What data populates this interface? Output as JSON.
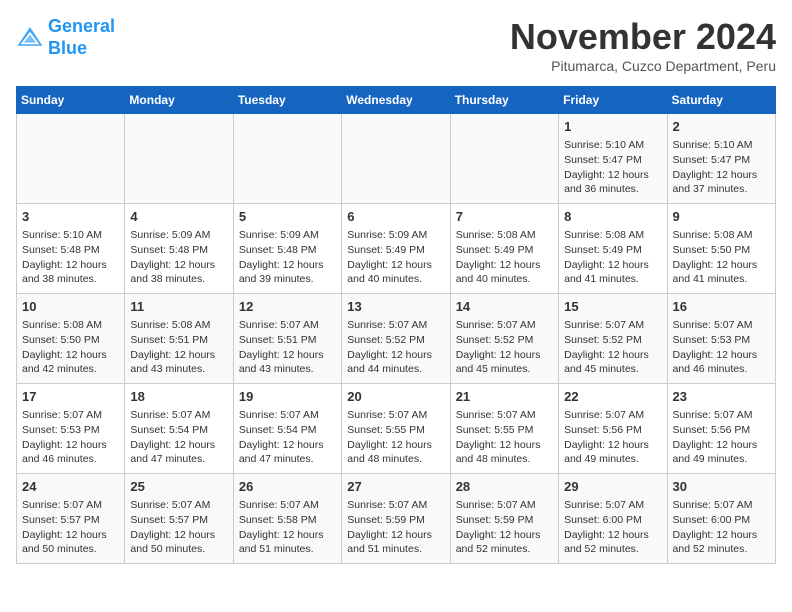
{
  "header": {
    "logo_line1": "General",
    "logo_line2": "Blue",
    "month": "November 2024",
    "location": "Pitumarca, Cuzco Department, Peru"
  },
  "days_of_week": [
    "Sunday",
    "Monday",
    "Tuesday",
    "Wednesday",
    "Thursday",
    "Friday",
    "Saturday"
  ],
  "weeks": [
    [
      {
        "day": "",
        "info": ""
      },
      {
        "day": "",
        "info": ""
      },
      {
        "day": "",
        "info": ""
      },
      {
        "day": "",
        "info": ""
      },
      {
        "day": "",
        "info": ""
      },
      {
        "day": "1",
        "info": "Sunrise: 5:10 AM\nSunset: 5:47 PM\nDaylight: 12 hours and 36 minutes."
      },
      {
        "day": "2",
        "info": "Sunrise: 5:10 AM\nSunset: 5:47 PM\nDaylight: 12 hours and 37 minutes."
      }
    ],
    [
      {
        "day": "3",
        "info": "Sunrise: 5:10 AM\nSunset: 5:48 PM\nDaylight: 12 hours and 38 minutes."
      },
      {
        "day": "4",
        "info": "Sunrise: 5:09 AM\nSunset: 5:48 PM\nDaylight: 12 hours and 38 minutes."
      },
      {
        "day": "5",
        "info": "Sunrise: 5:09 AM\nSunset: 5:48 PM\nDaylight: 12 hours and 39 minutes."
      },
      {
        "day": "6",
        "info": "Sunrise: 5:09 AM\nSunset: 5:49 PM\nDaylight: 12 hours and 40 minutes."
      },
      {
        "day": "7",
        "info": "Sunrise: 5:08 AM\nSunset: 5:49 PM\nDaylight: 12 hours and 40 minutes."
      },
      {
        "day": "8",
        "info": "Sunrise: 5:08 AM\nSunset: 5:49 PM\nDaylight: 12 hours and 41 minutes."
      },
      {
        "day": "9",
        "info": "Sunrise: 5:08 AM\nSunset: 5:50 PM\nDaylight: 12 hours and 41 minutes."
      }
    ],
    [
      {
        "day": "10",
        "info": "Sunrise: 5:08 AM\nSunset: 5:50 PM\nDaylight: 12 hours and 42 minutes."
      },
      {
        "day": "11",
        "info": "Sunrise: 5:08 AM\nSunset: 5:51 PM\nDaylight: 12 hours and 43 minutes."
      },
      {
        "day": "12",
        "info": "Sunrise: 5:07 AM\nSunset: 5:51 PM\nDaylight: 12 hours and 43 minutes."
      },
      {
        "day": "13",
        "info": "Sunrise: 5:07 AM\nSunset: 5:52 PM\nDaylight: 12 hours and 44 minutes."
      },
      {
        "day": "14",
        "info": "Sunrise: 5:07 AM\nSunset: 5:52 PM\nDaylight: 12 hours and 45 minutes."
      },
      {
        "day": "15",
        "info": "Sunrise: 5:07 AM\nSunset: 5:52 PM\nDaylight: 12 hours and 45 minutes."
      },
      {
        "day": "16",
        "info": "Sunrise: 5:07 AM\nSunset: 5:53 PM\nDaylight: 12 hours and 46 minutes."
      }
    ],
    [
      {
        "day": "17",
        "info": "Sunrise: 5:07 AM\nSunset: 5:53 PM\nDaylight: 12 hours and 46 minutes."
      },
      {
        "day": "18",
        "info": "Sunrise: 5:07 AM\nSunset: 5:54 PM\nDaylight: 12 hours and 47 minutes."
      },
      {
        "day": "19",
        "info": "Sunrise: 5:07 AM\nSunset: 5:54 PM\nDaylight: 12 hours and 47 minutes."
      },
      {
        "day": "20",
        "info": "Sunrise: 5:07 AM\nSunset: 5:55 PM\nDaylight: 12 hours and 48 minutes."
      },
      {
        "day": "21",
        "info": "Sunrise: 5:07 AM\nSunset: 5:55 PM\nDaylight: 12 hours and 48 minutes."
      },
      {
        "day": "22",
        "info": "Sunrise: 5:07 AM\nSunset: 5:56 PM\nDaylight: 12 hours and 49 minutes."
      },
      {
        "day": "23",
        "info": "Sunrise: 5:07 AM\nSunset: 5:56 PM\nDaylight: 12 hours and 49 minutes."
      }
    ],
    [
      {
        "day": "24",
        "info": "Sunrise: 5:07 AM\nSunset: 5:57 PM\nDaylight: 12 hours and 50 minutes."
      },
      {
        "day": "25",
        "info": "Sunrise: 5:07 AM\nSunset: 5:57 PM\nDaylight: 12 hours and 50 minutes."
      },
      {
        "day": "26",
        "info": "Sunrise: 5:07 AM\nSunset: 5:58 PM\nDaylight: 12 hours and 51 minutes."
      },
      {
        "day": "27",
        "info": "Sunrise: 5:07 AM\nSunset: 5:59 PM\nDaylight: 12 hours and 51 minutes."
      },
      {
        "day": "28",
        "info": "Sunrise: 5:07 AM\nSunset: 5:59 PM\nDaylight: 12 hours and 52 minutes."
      },
      {
        "day": "29",
        "info": "Sunrise: 5:07 AM\nSunset: 6:00 PM\nDaylight: 12 hours and 52 minutes."
      },
      {
        "day": "30",
        "info": "Sunrise: 5:07 AM\nSunset: 6:00 PM\nDaylight: 12 hours and 52 minutes."
      }
    ]
  ]
}
